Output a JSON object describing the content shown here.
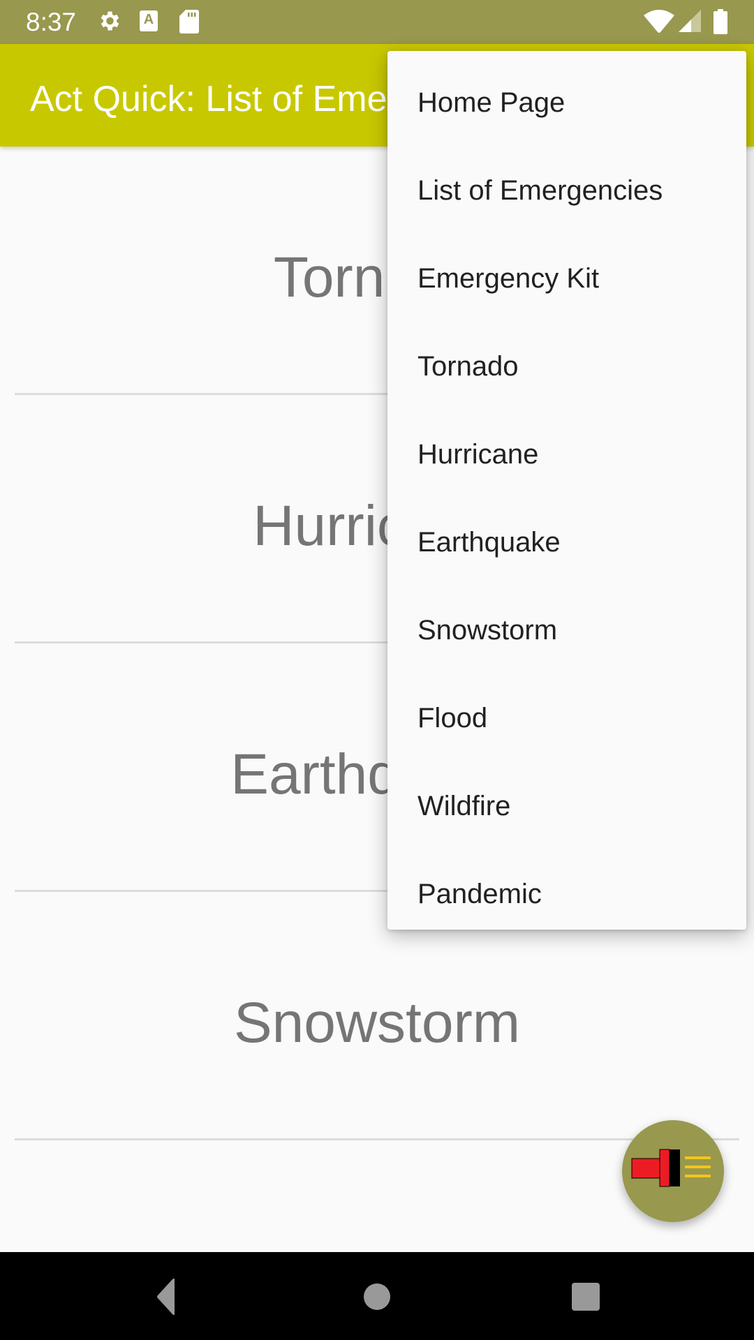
{
  "status_bar": {
    "time": "8:37",
    "icons": [
      "gear-icon",
      "a-keyboard-icon",
      "sd-card-icon",
      "wifi-icon",
      "signal-icon",
      "battery-icon"
    ]
  },
  "app_bar": {
    "title": "Act Quick: List of Emergencies"
  },
  "list": {
    "items": [
      {
        "label": "Tornado"
      },
      {
        "label": "Hurricane"
      },
      {
        "label": "Earthquake"
      },
      {
        "label": "Snowstorm"
      }
    ]
  },
  "menu": {
    "items": [
      {
        "label": "Home Page"
      },
      {
        "label": "List of Emergencies"
      },
      {
        "label": "Emergency Kit"
      },
      {
        "label": "Tornado"
      },
      {
        "label": "Hurricane"
      },
      {
        "label": "Earthquake"
      },
      {
        "label": "Snowstorm"
      },
      {
        "label": "Flood"
      },
      {
        "label": "Wildfire"
      },
      {
        "label": "Pandemic"
      }
    ]
  },
  "fab": {
    "icon": "flashlight-icon"
  },
  "nav_bar": {
    "buttons": [
      "back-icon",
      "home-icon",
      "recents-icon"
    ]
  },
  "colors": {
    "status_bar": "#98984e",
    "app_bar": "#c8c800",
    "fab": "#98984e",
    "list_text": "#757575",
    "menu_text": "#212121"
  }
}
